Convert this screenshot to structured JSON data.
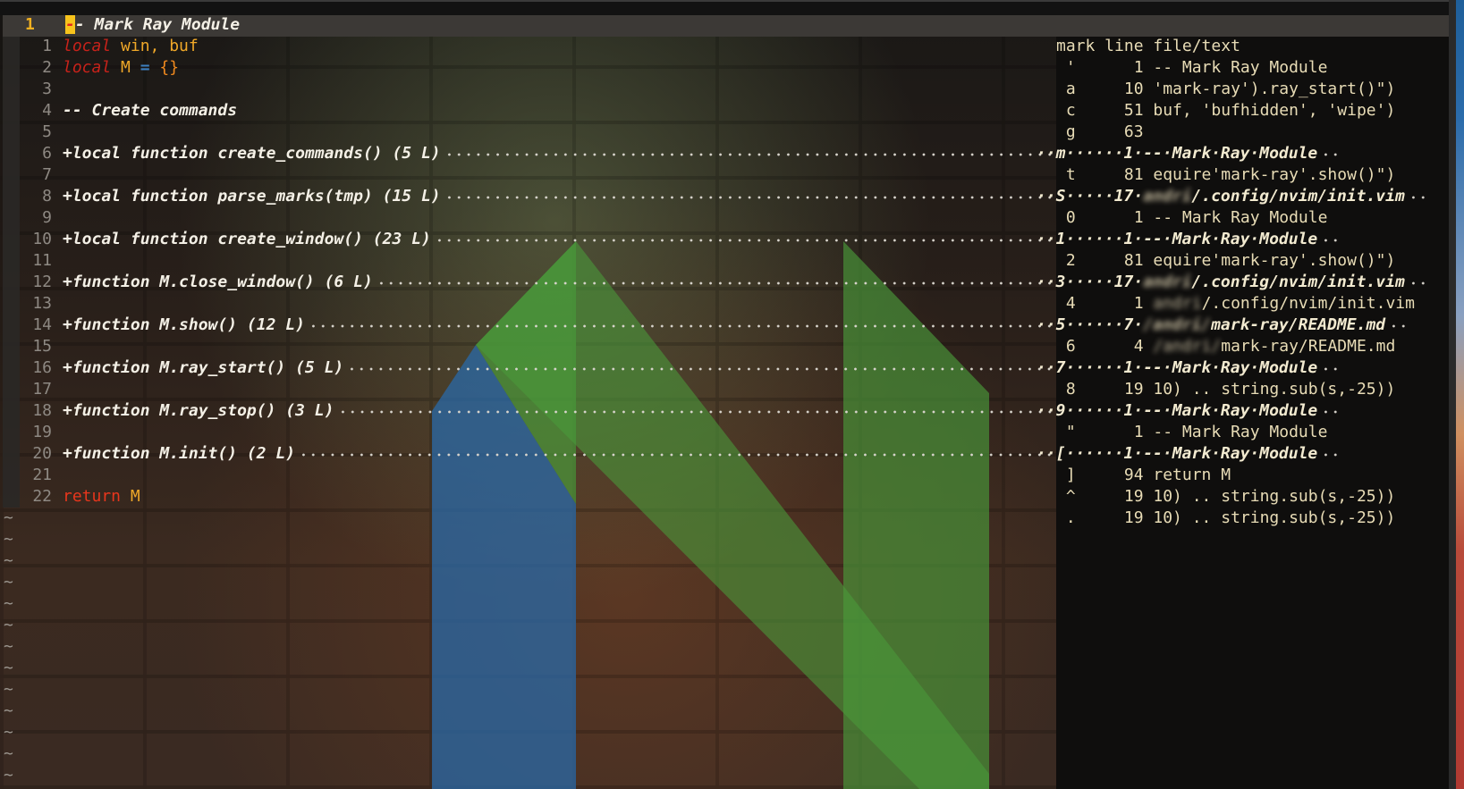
{
  "header": {
    "line_number": "1",
    "cursor_char": "-",
    "title_rest": "- Mark Ray Module"
  },
  "editor": {
    "lines": [
      {
        "n": "1",
        "segs": [
          {
            "t": "local",
            "c": "kw"
          },
          {
            "t": " win, buf",
            "c": "var"
          }
        ]
      },
      {
        "n": "2",
        "segs": [
          {
            "t": "local",
            "c": "kw"
          },
          {
            "t": " M ",
            "c": "var"
          },
          {
            "t": "=",
            "c": "op"
          },
          {
            "t": " {}",
            "c": "brace"
          }
        ]
      },
      {
        "n": "3",
        "segs": []
      },
      {
        "n": "4",
        "segs": [
          {
            "t": "-- Create commands",
            "c": "cm"
          }
        ]
      },
      {
        "n": "5",
        "segs": []
      },
      {
        "n": "6",
        "fold": "+local function create_commands() (5 L)"
      },
      {
        "n": "7",
        "segs": []
      },
      {
        "n": "8",
        "fold": "+local function parse_marks(tmp) (15 L)"
      },
      {
        "n": "9",
        "segs": []
      },
      {
        "n": "10",
        "fold": "+local function create_window() (23 L)"
      },
      {
        "n": "11",
        "segs": []
      },
      {
        "n": "12",
        "fold": "+function M.close_window() (6 L)"
      },
      {
        "n": "13",
        "segs": []
      },
      {
        "n": "14",
        "fold": "+function M.show() (12 L)"
      },
      {
        "n": "15",
        "segs": []
      },
      {
        "n": "16",
        "fold": "+function M.ray_start() (5 L)"
      },
      {
        "n": "17",
        "segs": []
      },
      {
        "n": "18",
        "fold": "+function M.ray_stop() (3 L)"
      },
      {
        "n": "19",
        "segs": []
      },
      {
        "n": "20",
        "fold": "+function M.init() (2 L)"
      },
      {
        "n": "21",
        "segs": []
      },
      {
        "n": "22",
        "segs": [
          {
            "t": "return",
            "c": "ret"
          },
          {
            "t": " M",
            "c": "var"
          }
        ]
      }
    ],
    "tilde": "~",
    "tilde_count": 13
  },
  "marks": {
    "header": "mark line file/text",
    "rows": [
      {
        "text": " '      1 -- Mark Ray Module"
      },
      {
        "text": " a     10 'mark-ray').ray_start()\")"
      },
      {
        "text": " c     51 buf, 'bufhidden', 'wipe')"
      },
      {
        "text": " g     63"
      },
      {
        "text": "··m······1·--·Mark·Ray·Module",
        "fold": true
      },
      {
        "text": " t     81 equire'mark-ray'.show()\")"
      },
      {
        "text": "··S·····17·",
        "blur": "andri",
        "rest": "/.config/nvim/init.vim",
        "fold": true
      },
      {
        "text": " 0      1 -- Mark Ray Module"
      },
      {
        "text": "··1······1·--·Mark·Ray·Module",
        "fold": true
      },
      {
        "text": " 2     81 equire'mark-ray'.show()\")"
      },
      {
        "text": "··3·····17·",
        "blur": "andri",
        "rest": "/.config/nvim/init.vim",
        "fold": true
      },
      {
        "text": " 4      1 ",
        "blur": "andri",
        "rest": "/.config/nvim/init.vim"
      },
      {
        "text": "··5······7·",
        "blur": "/andri/",
        "rest": "mark-ray/README.md",
        "fold": true
      },
      {
        "text": " 6      4 ",
        "blur": "/andri/",
        "rest": "mark-ray/README.md"
      },
      {
        "text": "··7······1·--·Mark·Ray·Module",
        "fold": true
      },
      {
        "text": " 8     19 10) .. string.sub(s,-25))"
      },
      {
        "text": "··9······1·--·Mark·Ray·Module",
        "fold": true
      },
      {
        "text": " \"      1 -- Mark Ray Module"
      },
      {
        "text": "··[······1·--·Mark·Ray·Module",
        "fold": true
      },
      {
        "text": " ]     94 return M"
      },
      {
        "text": " ^     19 10) .. string.sub(s,-25))"
      },
      {
        "text": " .     19 10) .. string.sub(s,-25))"
      }
    ]
  },
  "colors": {
    "accent": "#f7c31c",
    "keyword": "#c8221a",
    "variable": "#f0a828",
    "marks_text": "#e8dcb6",
    "logo_blue": "#2a6aa8",
    "logo_green": "#4a9a3a"
  }
}
